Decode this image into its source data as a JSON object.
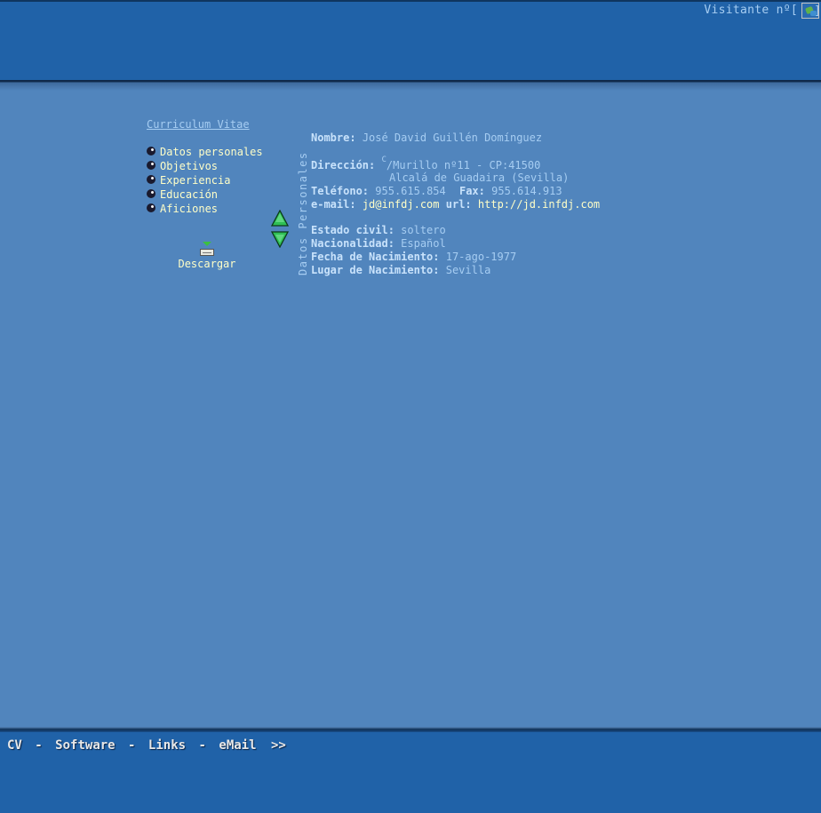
{
  "header": {
    "visitor_label": "Visitante nº[",
    "visitor_close": "]"
  },
  "sidebar": {
    "title": "Curriculum Vitae",
    "items": [
      {
        "label": "Datos personales"
      },
      {
        "label": "Objetivos"
      },
      {
        "label": "Experiencia"
      },
      {
        "label": "Educación"
      },
      {
        "label": "Aficiones"
      }
    ],
    "download_label": "Descargar"
  },
  "section": {
    "title": "Datos Personales"
  },
  "details": {
    "nombre_label": "Nombre:",
    "nombre_value": "José David Guillén Domínguez",
    "direccion_label": "Dirección:",
    "direccion_sup": "C",
    "direccion_line1": "/Murillo nº11 - CP:41500",
    "direccion_line2": "Alcalá de Guadaira (Sevilla)",
    "telefono_label": "Teléfono:",
    "telefono_value": "955.615.854",
    "fax_label": "Fax:",
    "fax_value": "955.614.913",
    "email_label": "e-mail:",
    "email_value": "jd@infdj.com",
    "url_label": "url:",
    "url_value": "http://jd.infdj.com",
    "estado_label": "Estado civil:",
    "estado_value": "soltero",
    "nacionalidad_label": "Nacionalidad:",
    "nacionalidad_value": "Español",
    "fecha_label": "Fecha de Nacimiento:",
    "fecha_value": "17-ago-1977",
    "lugar_label": "Lugar de Nacimiento:",
    "lugar_value": "Sevilla"
  },
  "footer": {
    "items": [
      "CV",
      "Software",
      "Links",
      "eMail"
    ],
    "separator": "-",
    "more": ">>"
  },
  "colors": {
    "background": "#5185bd",
    "bar": "#2062a8",
    "link_yellow": "#ffffc8",
    "text_light_blue": "#a6cdf2"
  },
  "icons": {
    "bullet": "bullet-icon",
    "download": "download-icon",
    "up": "arrow-up-icon",
    "down": "arrow-down-icon",
    "counter": "broken-image-icon"
  }
}
